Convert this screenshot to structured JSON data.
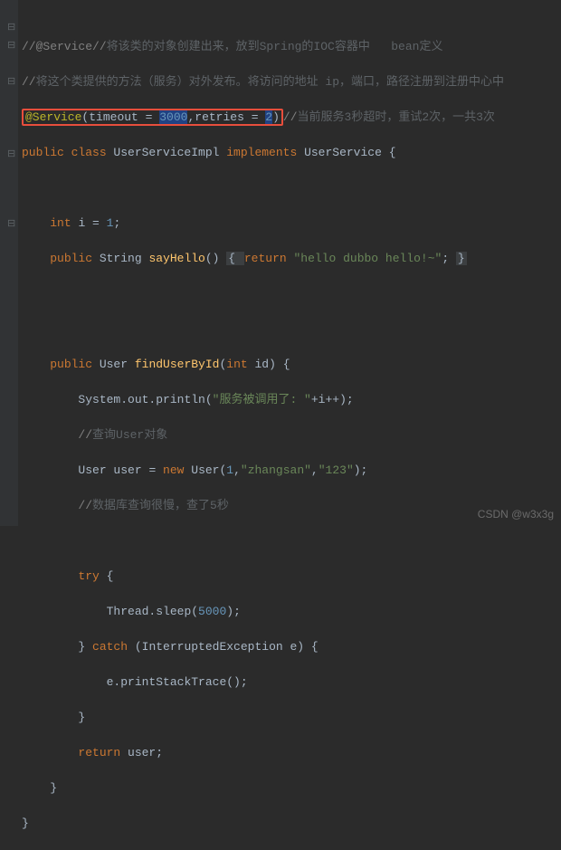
{
  "comment1_prefix": "//@Service//",
  "comment1_text": "将该类的对象创建出来，放到Spring的IOC容器中   bean定义",
  "comment2_prefix": "//",
  "comment2_text": "将这个类提供的方法（服务）对外发布。将访问的地址 ip，端口，路径注册到注册中心中",
  "anno_name": "@Service",
  "anno_open": "(",
  "anno_arg1_key": "timeout = ",
  "anno_arg1_val": "3000",
  "anno_sep": ",",
  "anno_arg2_key": "retries = ",
  "anno_arg2_val": "2",
  "anno_close": ")",
  "comment3_prefix": "//",
  "comment3_text": "当前服务3秒超时，重试2次，一共3次",
  "decl_public": "public ",
  "decl_class": "class ",
  "decl_name": "UserServiceImpl ",
  "decl_impl": "implements ",
  "decl_iface": "UserService {",
  "field_type": "int ",
  "field_name": "i ",
  "field_eq": "= ",
  "field_val": "1",
  "field_semi": ";",
  "m1_pub": "public ",
  "m1_ret": "String ",
  "m1_name": "sayHello",
  "m1_args": "() ",
  "m1_ob": "{ ",
  "m1_return": "return ",
  "m1_str": "\"hello dubbo hello!~\"",
  "m1_semi": "; ",
  "m1_cb": "}",
  "m2_pub": "public ",
  "m2_ret": "User ",
  "m2_name": "findUserById",
  "m2_op": "(",
  "m2_ptype": "int ",
  "m2_pname": "id",
  "m2_cp": ") {",
  "m2_l1a": "System.out.println(",
  "m2_l1_str": "\"服务被调用了: \"",
  "m2_l1b": "+i++);",
  "m2_l2_prefix": "//",
  "m2_l2_text": "查询User对象",
  "m2_l3a": "User user ",
  "m2_l3eq": "= ",
  "m2_l3_new": "new ",
  "m2_l3_cls": "User(",
  "m2_l3_n1": "1",
  "m2_l3_c1": ",",
  "m2_l3_s1": "\"zhangsan\"",
  "m2_l3_c2": ",",
  "m2_l3_s2": "\"123\"",
  "m2_l3_end": ");",
  "m2_l4_prefix": "//",
  "m2_l4_text": "数据库查询很慢，查了5秒",
  "try_kw": "try ",
  "try_ob": "{",
  "sleep_a": "Thread.sleep(",
  "sleep_n": "5000",
  "sleep_b": ");",
  "try_cb": "} ",
  "catch_kw": "catch ",
  "catch_args": "(InterruptedException e) {",
  "catch_body": "e.printStackTrace();",
  "catch_cb": "}",
  "ret_kw": "return ",
  "ret_val": "user",
  "ret_semi": ";",
  "close1": "}",
  "close2": "}",
  "watermark": "CSDN @w3x3g"
}
